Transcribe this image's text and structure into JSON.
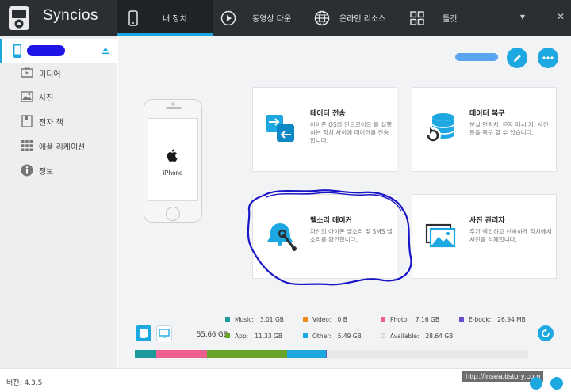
{
  "app": {
    "name": "Syncios"
  },
  "tabs": [
    {
      "label": "내 장치",
      "icon": "phone-icon",
      "active": true
    },
    {
      "label": "동영상 다운",
      "icon": "play-icon",
      "active": false
    },
    {
      "label": "온라인 리소스",
      "icon": "globe-icon",
      "active": false
    },
    {
      "label": "툴킷",
      "icon": "grid-icon",
      "active": false
    }
  ],
  "sidebar": {
    "device": {
      "icon": "iphone-icon",
      "name_redacted": true
    },
    "items": [
      {
        "label": "미디어",
        "icon": "tv-icon"
      },
      {
        "label": "사진",
        "icon": "photo-icon"
      },
      {
        "label": "전자 책",
        "icon": "book-icon"
      },
      {
        "label": "애플 리케이션",
        "icon": "apps-grid-icon"
      },
      {
        "label": "정보",
        "icon": "info-icon"
      }
    ]
  },
  "device": {
    "model_label": "iPhone"
  },
  "cards": [
    {
      "title": "데이터 전송",
      "desc": "아이폰 OS와 안드로이드 를 실행하는 장치 사이에 데이터를 전송합니다.",
      "icon": "transfer-icon"
    },
    {
      "title": "데이터 복구",
      "desc": "분실 연락처, 문자 메시 지, 사진 등을 복구 할 수 있습니다.",
      "icon": "database-restore-icon"
    },
    {
      "title": "벨소리 메이커",
      "desc": "자신의 아이폰 벨소리 및 SMS 벨소리를 확인합니다.",
      "icon": "ringtone-maker-icon"
    },
    {
      "title": "사진 관리자",
      "desc": "추가 백업하고 신속하게 장치에서 사진을 삭제합니다.",
      "icon": "photo-manager-icon"
    }
  ],
  "storage": {
    "total": "55.66 GB",
    "legend": [
      {
        "label": "Music:",
        "value": "3.01 GB",
        "color": "#1c9a9a"
      },
      {
        "label": "Video:",
        "value": "0 B",
        "color": "#f08a1c"
      },
      {
        "label": "Photo:",
        "value": "7.16 GB",
        "color": "#ec5f8f"
      },
      {
        "label": "E-book:",
        "value": "26.94 MB",
        "color": "#6a4fc8"
      },
      {
        "label": "App:",
        "value": "11.33 GB",
        "color": "#6aa329"
      },
      {
        "label": "Other:",
        "value": "5.49 GB",
        "color": "#1ea8e2"
      },
      {
        "label": "Available:",
        "value": "28.64 GB",
        "color": "#e6e8ea"
      }
    ],
    "usage_gb": {
      "music": 3.01,
      "video": 0,
      "photo": 7.16,
      "ebook": 0.027,
      "app": 11.33,
      "other": 5.49,
      "available": 28.64
    }
  },
  "status": {
    "version": "버전: 4.3.5",
    "watermark": "http://insea.tistory.com"
  }
}
